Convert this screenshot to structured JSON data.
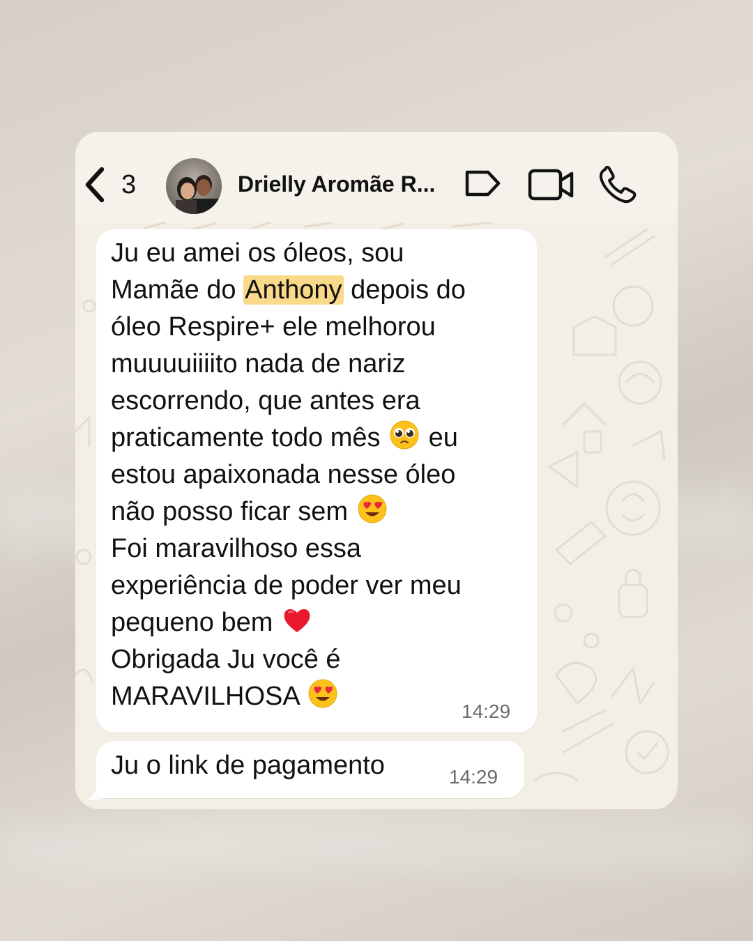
{
  "header": {
    "back_count": "3",
    "contact_name": "Drielly Aromãe R...",
    "icons": [
      "chevron-left-icon",
      "label-tag-icon",
      "video-call-icon",
      "phone-call-icon"
    ]
  },
  "messages": [
    {
      "lines": [
        "Ju eu amei os óleos, sou",
        "Mamãe do",
        "Anthony",
        "depois do",
        "óleo Respire+ ele melhorou",
        "muuuuiiiito nada de nariz",
        "escorrendo, que antes era",
        "praticamente todo mês",
        "eu",
        "estou apaixonada nesse óleo",
        "não posso ficar sem",
        "Foi maravilhoso essa",
        "experiência de poder ver meu",
        "pequeno bem",
        "Obrigada Ju você é",
        "MARAVILHOSA"
      ],
      "highlighted_word": "Anthony",
      "time": "14:29"
    },
    {
      "text": "Ju o link de pagamento",
      "time": "14:29"
    }
  ],
  "colors": {
    "bubble": "#ffffff",
    "highlight": "#fbd98a",
    "chat_background": "#f4efe6",
    "header_background": "#f5f2ec"
  }
}
